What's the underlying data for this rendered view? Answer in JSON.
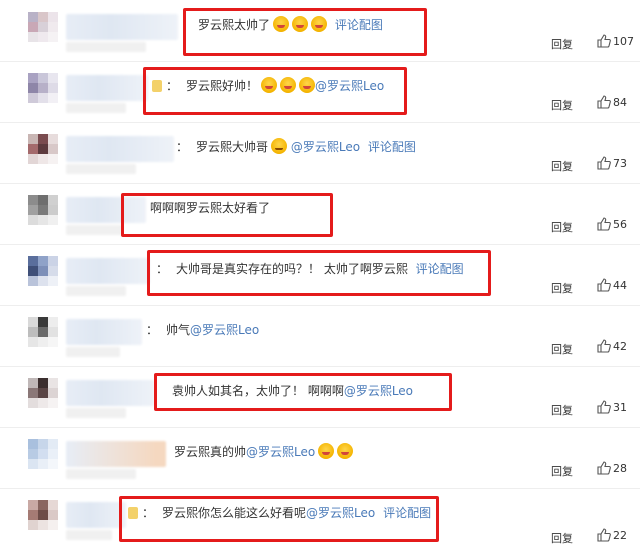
{
  "reply_label": "回复",
  "comments": [
    {
      "prefix": "",
      "text": "罗云熙太帅了",
      "emoji": 3,
      "emoji_after": "",
      "mention": "",
      "pic": "评论配图",
      "likes": "107"
    },
    {
      "prefix": "：",
      "text": "罗云熙好帅！",
      "emoji": 3,
      "emoji_after": "",
      "mention": "@罗云熙Leo",
      "pic": "",
      "likes": "84"
    },
    {
      "prefix": "：",
      "text": "罗云熙大帅哥",
      "emoji": 1,
      "emoji_after": "",
      "mention": "@罗云熙Leo",
      "pic": "评论配图",
      "likes": "73"
    },
    {
      "prefix": "",
      "text": "啊啊啊罗云熙太好看了",
      "emoji": 0,
      "emoji_after": "",
      "mention": "",
      "pic": "",
      "likes": "56"
    },
    {
      "prefix": "：",
      "text": "大帅哥是真实存在的吗？！ 太帅了啊罗云熙",
      "emoji": 0,
      "emoji_after": "",
      "mention": "",
      "pic": "评论配图",
      "likes": "44"
    },
    {
      "prefix": "：",
      "text": "帅气",
      "emoji": 0,
      "emoji_after": "",
      "mention": "@罗云熙Leo",
      "pic": "",
      "likes": "42"
    },
    {
      "prefix": "",
      "text": "袁帅人如其名，太帅了！ 啊啊啊",
      "emoji": 0,
      "emoji_after": "",
      "mention": "@罗云熙Leo",
      "pic": "",
      "likes": "31"
    },
    {
      "prefix": "",
      "text": "罗云熙真的帅",
      "emoji": 0,
      "emoji_after": "",
      "mention": "@罗云熙Leo",
      "pic": "",
      "likes": "28"
    },
    {
      "prefix": "：",
      "text": "罗云熙你怎么能这么好看呢",
      "emoji": 0,
      "emoji_after": "",
      "mention": "@罗云熙Leo",
      "pic": "评论配图",
      "likes": "22"
    }
  ],
  "colors": {
    "highlight": "#e41b1b",
    "link": "#4a7ab8"
  }
}
